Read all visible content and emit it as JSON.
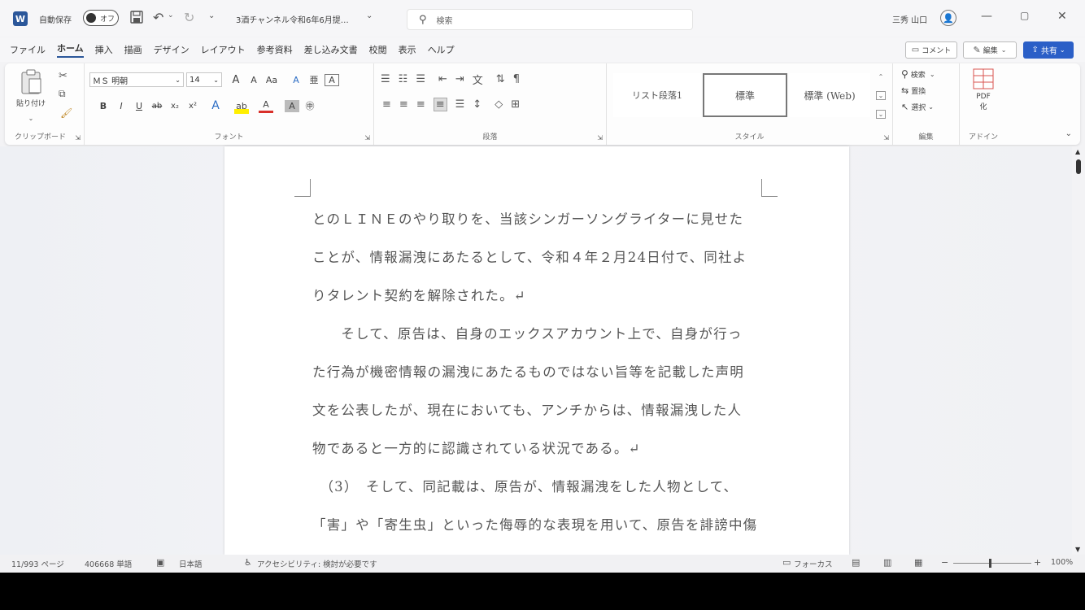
{
  "titlebar": {
    "autosave_label": "自動保存",
    "autosave_state": "オフ",
    "doc_title": "3酒チャンネル令和6年6月提…",
    "search_placeholder": "検索",
    "user_name": "三秀 山口"
  },
  "menu": {
    "tabs": [
      "ファイル",
      "ホーム",
      "挿入",
      "描画",
      "デザイン",
      "レイアウト",
      "参考資料",
      "差し込み文書",
      "校閲",
      "表示",
      "ヘルプ"
    ],
    "comment_label": "コメント",
    "edit_label": "編集",
    "share_label": "共有"
  },
  "ribbon": {
    "clipboard": {
      "paste": "貼り付け",
      "label": "クリップボード"
    },
    "font": {
      "name": "ＭＳ 明朝",
      "size": "14",
      "label": "フォント",
      "bold": "B",
      "italic": "I",
      "underline": "U",
      "strike": "ab",
      "sub": "x₂",
      "sup": "x²",
      "grow": "A",
      "shrink": "A",
      "case": "Aa",
      "clear": "A",
      "ruby": "亜",
      "border": "A",
      "effects": "A",
      "highlight": "ab",
      "color": "A",
      "shade": "A",
      "circle": "㊥"
    },
    "paragraph": {
      "label": "段落"
    },
    "styles": {
      "items": [
        "リスト段落1",
        "標準",
        "標準 (Web)"
      ],
      "label": "スタイル"
    },
    "editing": {
      "find": "検索",
      "replace": "置換",
      "select": "選択",
      "label": "編集"
    },
    "addin": {
      "name": "PDF",
      "sub": "化",
      "label": "アドイン"
    }
  },
  "document": {
    "lines": [
      "とのＬＩＮＥのやり取りを、当該シンガーソングライターに見せた",
      "ことが、情報漏洩にあたるとして、令和４年２月24日付で、同社よ",
      "りタレント契約を解除された。↵",
      "　　そして、原告は、自身のエックスアカウント上で、自身が行っ",
      "た行為が機密情報の漏洩にあたるものではない旨等を記載した声明",
      "文を公表したが、現在においても、アンチからは、情報漏洩した人",
      "物であると一方的に認識されている状況である。↵",
      "　（3）　そして、同記載は、原告が、情報漏洩をした人物として、",
      "「害」や「寄生虫」といった侮辱的な表現を用いて、原告を誹謗中傷"
    ]
  },
  "status": {
    "page": "11/993 ページ",
    "words": "406668 単語",
    "lang": "日本語",
    "accessibility": "アクセシビリティ: 検討が必要です",
    "focus": "フォーカス",
    "zoom": "100%"
  }
}
